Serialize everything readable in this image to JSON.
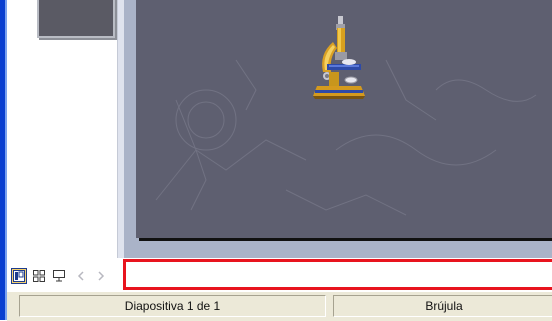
{
  "statusbar": {
    "slide_indicator": "Diapositiva 1 de 1",
    "design_template": "Brújula"
  },
  "view_buttons": [
    {
      "name": "normal-view",
      "icon": "normal-view-icon",
      "active": true
    },
    {
      "name": "slide-sorter-view",
      "icon": "slide-sorter-icon",
      "active": false
    },
    {
      "name": "slide-show-view",
      "icon": "slide-show-icon",
      "active": false
    },
    {
      "name": "scroll-left",
      "icon": "scroll-left-icon",
      "active": false
    },
    {
      "name": "scroll-right",
      "icon": "scroll-right-icon",
      "active": false
    }
  ],
  "slide": {
    "image": "microscope-clipart",
    "background_color": "#5e5f70"
  },
  "notes": {
    "value": ""
  },
  "colors": {
    "window_border": "#0a3fd0",
    "notes_highlight": "#e8141e",
    "statusbar_bg": "#ece9d8"
  }
}
